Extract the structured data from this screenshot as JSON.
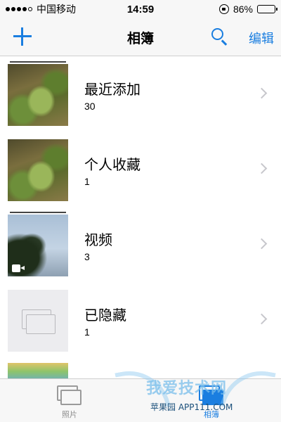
{
  "status_bar": {
    "carrier": "中国移动",
    "time": "14:59",
    "battery": "86%",
    "battery_level": 0.86
  },
  "nav": {
    "title": "相簿",
    "edit_label": "编辑"
  },
  "albums": [
    {
      "title": "最近添加",
      "count": "30",
      "thumbnail": "plants"
    },
    {
      "title": "个人收藏",
      "count": "1",
      "thumbnail": "plants"
    },
    {
      "title": "视频",
      "count": "3",
      "thumbnail": "sky",
      "badge_icon": "video-camera-icon"
    },
    {
      "title": "已隐藏",
      "count": "1",
      "thumbnail": "empty-stack",
      "placeholder_icon": "stacked-photos-icon"
    }
  ],
  "tabs": [
    {
      "label": "照片",
      "icon": "photos-icon",
      "selected": false
    },
    {
      "label": "相簿",
      "icon": "albums-icon",
      "selected": true
    }
  ],
  "watermark": {
    "text": "我爱技术网",
    "sub": "苹果园 APP111.COM"
  },
  "colors": {
    "accent": "#1a7ee0",
    "bar_background": "#f7f7f7",
    "chevron": "#c7c7cc"
  }
}
